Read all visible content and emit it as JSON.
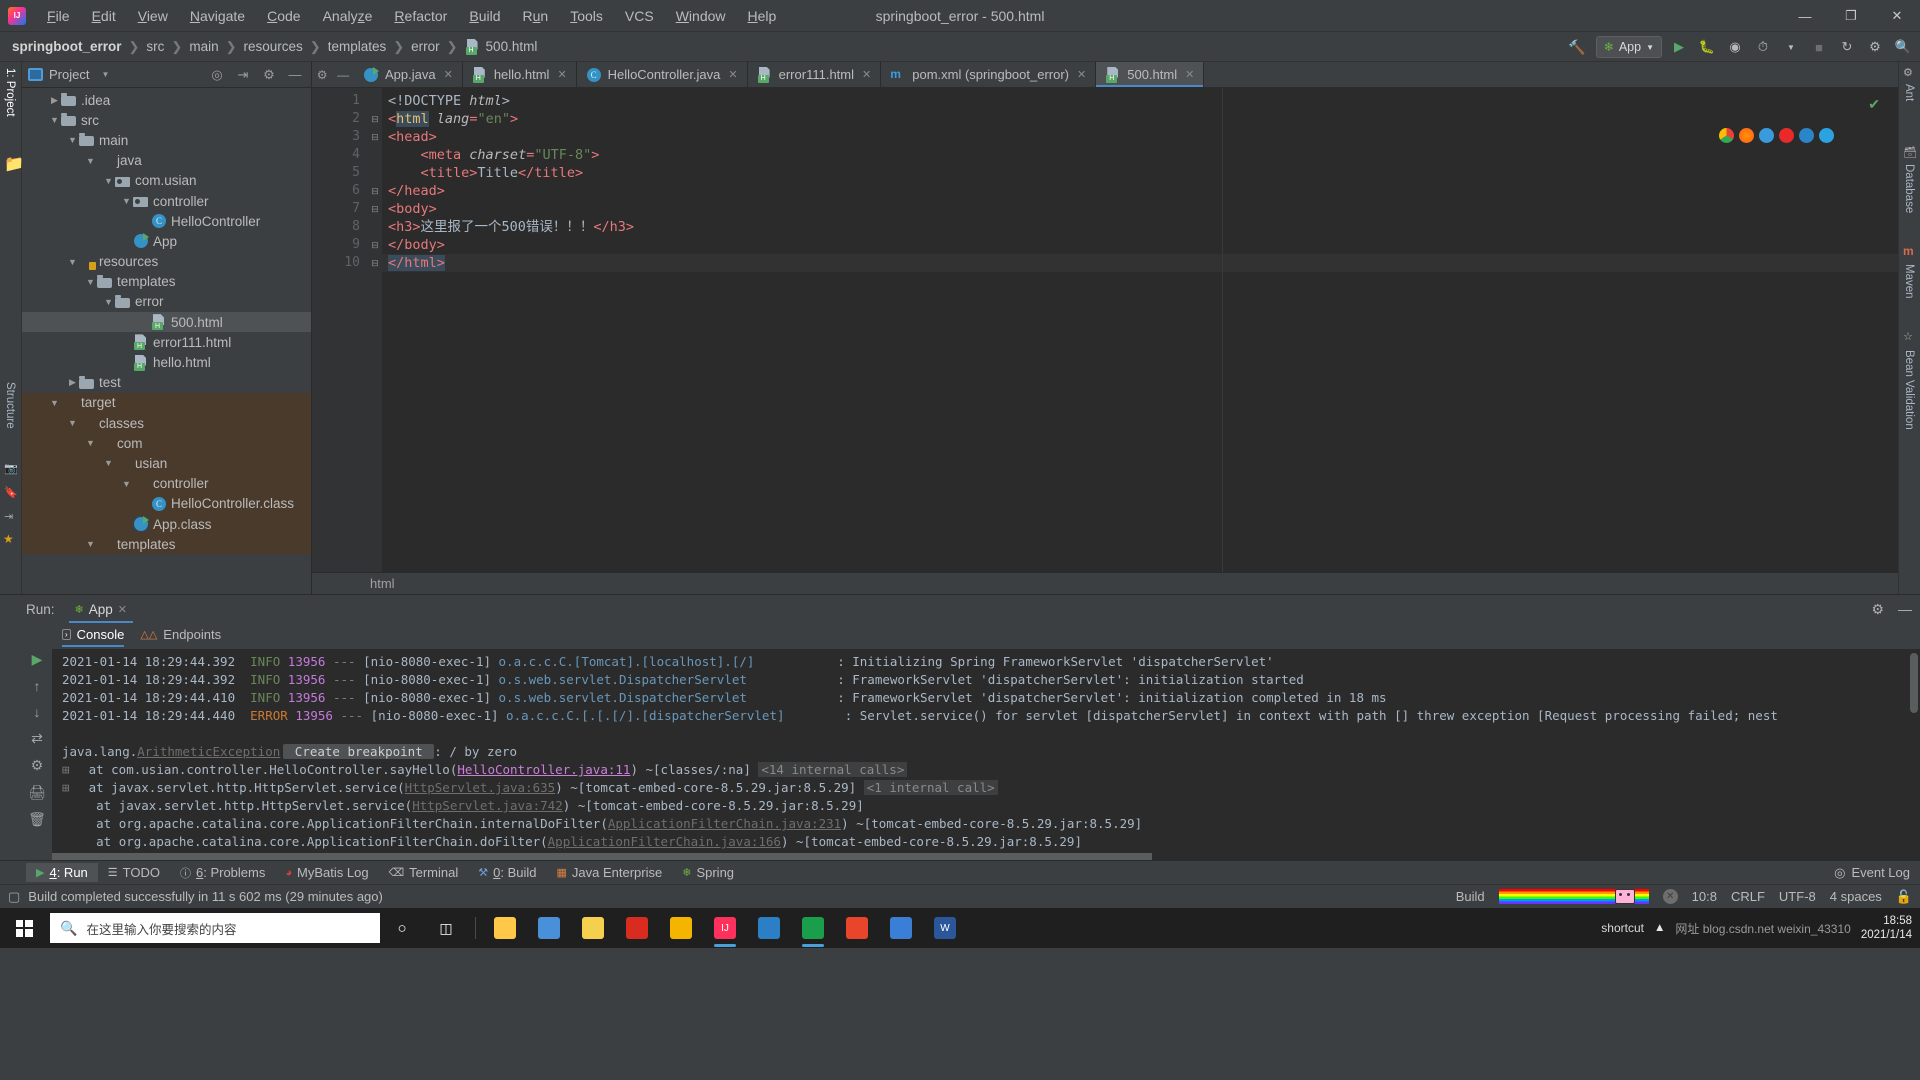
{
  "titlebar": {
    "window_title": "springboot_error - 500.html",
    "logo_icon": "intellij-idea-logo",
    "menus": [
      {
        "label": "File",
        "mnemonic": "F"
      },
      {
        "label": "Edit",
        "mnemonic": "E"
      },
      {
        "label": "View",
        "mnemonic": "V"
      },
      {
        "label": "Navigate",
        "mnemonic": "N"
      },
      {
        "label": "Code",
        "mnemonic": "C"
      },
      {
        "label": "Analyze",
        "mnemonic": "z"
      },
      {
        "label": "Refactor",
        "mnemonic": "R"
      },
      {
        "label": "Build",
        "mnemonic": "B"
      },
      {
        "label": "Run",
        "mnemonic": "u"
      },
      {
        "label": "Tools",
        "mnemonic": "T"
      },
      {
        "label": "VCS",
        "mnemonic": ""
      },
      {
        "label": "Window",
        "mnemonic": "W"
      },
      {
        "label": "Help",
        "mnemonic": "H"
      }
    ],
    "controls": {
      "minimize": "—",
      "maximize": "❐",
      "close": "✕"
    }
  },
  "navbar": {
    "crumbs": [
      "springboot_error",
      "src",
      "main",
      "resources",
      "templates",
      "error",
      "500.html"
    ],
    "separator": "❯",
    "hammer_icon": "build-hammer-icon",
    "run_config": "App",
    "run_config_icon": "spring-boot-icon",
    "actions": [
      "run-icon",
      "debug-icon",
      "run-with-coverage-icon",
      "profile-icon",
      "stop-icon",
      "update-icon",
      "settings-icon",
      "search-icon"
    ]
  },
  "left_strip": {
    "tabs": [
      {
        "label": "1: Project",
        "active": true
      }
    ],
    "bottom_icons": [
      "structure-icon",
      "favorites-icon",
      "web-icon"
    ]
  },
  "project_panel": {
    "title": "Project",
    "title_icon": "project-view-icon",
    "dropdown_icon": "chevron-down-icon",
    "toolbar_icons": [
      "locate-icon",
      "collapse-all-icon",
      "settings-gear-icon",
      "hide-icon"
    ],
    "tree": [
      {
        "label": ".idea",
        "indent": 2,
        "arrow": "collapsed",
        "icon": "folder",
        "selected": false,
        "target": false
      },
      {
        "label": "src",
        "indent": 2,
        "arrow": "expanded",
        "icon": "folder",
        "selected": false,
        "target": false
      },
      {
        "label": "main",
        "indent": 3,
        "arrow": "expanded",
        "icon": "folder",
        "selected": false,
        "target": false
      },
      {
        "label": "java",
        "indent": 4,
        "arrow": "expanded",
        "icon": "folder-blue",
        "selected": false,
        "target": false
      },
      {
        "label": "com.usian",
        "indent": 5,
        "arrow": "expanded",
        "icon": "pkg",
        "selected": false,
        "target": false
      },
      {
        "label": "controller",
        "indent": 6,
        "arrow": "expanded",
        "icon": "pkg",
        "selected": false,
        "target": false
      },
      {
        "label": "HelloController",
        "indent": 7,
        "arrow": "none",
        "icon": "cls",
        "selected": false,
        "target": false
      },
      {
        "label": "App",
        "indent": 6,
        "arrow": "none",
        "icon": "app",
        "selected": false,
        "target": false
      },
      {
        "label": "resources",
        "indent": 3,
        "arrow": "expanded",
        "icon": "folder-res",
        "selected": false,
        "target": false
      },
      {
        "label": "templates",
        "indent": 4,
        "arrow": "expanded",
        "icon": "folder",
        "selected": false,
        "target": false
      },
      {
        "label": "error",
        "indent": 5,
        "arrow": "expanded",
        "icon": "folder",
        "selected": false,
        "target": false
      },
      {
        "label": "500.html",
        "indent": 7,
        "arrow": "none",
        "icon": "html",
        "selected": true,
        "target": false
      },
      {
        "label": "error111.html",
        "indent": 6,
        "arrow": "none",
        "icon": "html",
        "selected": false,
        "target": false
      },
      {
        "label": "hello.html",
        "indent": 6,
        "arrow": "none",
        "icon": "html",
        "selected": false,
        "target": false
      },
      {
        "label": "test",
        "indent": 3,
        "arrow": "collapsed",
        "icon": "folder",
        "selected": false,
        "target": false
      },
      {
        "label": "target",
        "indent": 2,
        "arrow": "expanded",
        "icon": "folder-orange",
        "selected": false,
        "target": true
      },
      {
        "label": "classes",
        "indent": 3,
        "arrow": "expanded",
        "icon": "folder-orange",
        "selected": false,
        "target": true
      },
      {
        "label": "com",
        "indent": 4,
        "arrow": "expanded",
        "icon": "folder-orange",
        "selected": false,
        "target": true
      },
      {
        "label": "usian",
        "indent": 5,
        "arrow": "expanded",
        "icon": "folder-orange",
        "selected": false,
        "target": true
      },
      {
        "label": "controller",
        "indent": 6,
        "arrow": "expanded",
        "icon": "folder-orange",
        "selected": false,
        "target": true
      },
      {
        "label": "HelloController.class",
        "indent": 7,
        "arrow": "none",
        "icon": "cls",
        "selected": false,
        "target": true
      },
      {
        "label": "App.class",
        "indent": 6,
        "arrow": "none",
        "icon": "app",
        "selected": false,
        "target": true
      },
      {
        "label": "templates",
        "indent": 4,
        "arrow": "expanded",
        "icon": "folder-orange",
        "selected": false,
        "target": true
      }
    ]
  },
  "editor": {
    "tabs": [
      {
        "label": "App.java",
        "icon": "spring-java-icon",
        "active": false
      },
      {
        "label": "hello.html",
        "icon": "html-file-icon",
        "active": false
      },
      {
        "label": "HelloController.java",
        "icon": "java-class-icon",
        "active": false
      },
      {
        "label": "error111.html",
        "icon": "html-file-icon",
        "active": false
      },
      {
        "label": "pom.xml (springboot_error)",
        "icon": "maven-icon",
        "active": false
      },
      {
        "label": "500.html",
        "icon": "html-file-icon",
        "active": true
      }
    ],
    "line_numbers": [
      "1",
      "2",
      "3",
      "4",
      "5",
      "6",
      "7",
      "8",
      "9",
      "10"
    ],
    "lines": [
      {
        "n": 1,
        "fold": "",
        "current": false,
        "tokens": [
          {
            "t": "<!DOCTYPE ",
            "c": "t-doctype"
          },
          {
            "t": "html",
            "c": "t-attr"
          },
          {
            "t": ">",
            "c": "t-doctype"
          }
        ],
        "indent": 0
      },
      {
        "n": 2,
        "fold": "-",
        "current": false,
        "tokens": [
          {
            "t": "<",
            "c": "t-pink"
          },
          {
            "t": "html",
            "c": "t-tag hl-match"
          },
          {
            "t": " ",
            "c": "t-text"
          },
          {
            "t": "lang",
            "c": "t-attr"
          },
          {
            "t": "=",
            "c": "t-pink"
          },
          {
            "t": "\"en\"",
            "c": "t-str"
          },
          {
            "t": ">",
            "c": "t-pink"
          }
        ],
        "indent": 0
      },
      {
        "n": 3,
        "fold": "-",
        "current": false,
        "tokens": [
          {
            "t": "<head>",
            "c": "t-pink"
          }
        ],
        "indent": 0
      },
      {
        "n": 4,
        "fold": "",
        "current": false,
        "tokens": [
          {
            "t": "    <",
            "c": "t-pink"
          },
          {
            "t": "meta",
            "c": "t-pink"
          },
          {
            "t": " ",
            "c": "t-text"
          },
          {
            "t": "charset",
            "c": "t-attr"
          },
          {
            "t": "=",
            "c": "t-pink"
          },
          {
            "t": "\"UTF-8\"",
            "c": "t-str"
          },
          {
            "t": ">",
            "c": "t-pink"
          }
        ],
        "indent": 0
      },
      {
        "n": 5,
        "fold": "",
        "current": false,
        "tokens": [
          {
            "t": "    <title>",
            "c": "t-pink"
          },
          {
            "t": "Title",
            "c": "t-text"
          },
          {
            "t": "</title>",
            "c": "t-pink"
          }
        ],
        "indent": 0
      },
      {
        "n": 6,
        "fold": "=",
        "current": false,
        "tokens": [
          {
            "t": "</head>",
            "c": "t-pink"
          }
        ],
        "indent": 0
      },
      {
        "n": 7,
        "fold": "-",
        "current": false,
        "tokens": [
          {
            "t": "<body>",
            "c": "t-pink"
          }
        ],
        "indent": 0
      },
      {
        "n": 8,
        "fold": "",
        "current": false,
        "tokens": [
          {
            "t": "<h3>",
            "c": "t-pink"
          },
          {
            "t": "这里报了一个500错误！！！",
            "c": "t-text"
          },
          {
            "t": "</h3>",
            "c": "t-pink"
          }
        ],
        "indent": 0
      },
      {
        "n": 9,
        "fold": "=",
        "current": false,
        "tokens": [
          {
            "t": "</body>",
            "c": "t-pink"
          }
        ],
        "indent": 0
      },
      {
        "n": 10,
        "fold": "=",
        "current": true,
        "tokens": [
          {
            "t": "</html>",
            "c": "t-pink hl-match"
          }
        ],
        "indent": 0
      }
    ],
    "inspection_status": "✔",
    "breadcrumb_bottom": "html",
    "browser_icons": [
      "chrome-icon",
      "firefox-icon",
      "safari-icon",
      "opera-icon",
      "edge-icon",
      "ie-icon"
    ]
  },
  "right_strip": {
    "tabs": [
      "Ant",
      "Database",
      "Maven",
      "Bean Validation"
    ]
  },
  "run_window": {
    "label": "Run:",
    "config_name": "App",
    "config_icon": "spring-boot-icon",
    "close_icon": "close-icon",
    "settings_icon": "gear-icon",
    "hide_icon": "minimize-icon",
    "tabs": [
      {
        "label": "Console",
        "icon": "console-icon",
        "active": true
      },
      {
        "label": "Endpoints",
        "icon": "endpoints-icon",
        "active": false
      }
    ],
    "toolbar_icons": [
      "rerun-icon",
      "scroll-up-icon",
      "scroll-down-icon",
      "soft-wrap-icon",
      "print-icon",
      "clear-all-icon"
    ],
    "console_lines": [
      {
        "date": "2021-01-14 18:29:44.392",
        "level": "INFO",
        "pid": "13956",
        "thread": "[nio-8080-exec-1]",
        "logger": "o.a.c.c.C.[Tomcat].[localhost].[/]",
        "logger_pad": 9,
        "message": ": Initializing Spring FrameworkServlet 'dispatcherServlet'"
      },
      {
        "date": "2021-01-14 18:29:44.392",
        "level": "INFO",
        "pid": "13956",
        "thread": "[nio-8080-exec-1]",
        "logger": "o.s.web.servlet.DispatcherServlet",
        "logger_pad": 9,
        "message": ": FrameworkServlet 'dispatcherServlet': initialization started"
      },
      {
        "date": "2021-01-14 18:29:44.410",
        "level": "INFO",
        "pid": "13956",
        "thread": "[nio-8080-exec-1]",
        "logger": "o.s.web.servlet.DispatcherServlet",
        "logger_pad": 9,
        "message": ": FrameworkServlet 'dispatcherServlet': initialization completed in 18 ms"
      },
      {
        "date": "2021-01-14 18:29:44.440",
        "level": "ERROR",
        "pid": "13956",
        "thread": "[nio-8080-exec-1]",
        "logger": "o.a.c.c.C.[.[.[/].[dispatcherServlet]",
        "logger_pad": 4,
        "message": ": Servlet.service() for servlet [dispatcherServlet] in context with path [] threw exception [Request processing failed; nest"
      }
    ],
    "exception_header": {
      "prefix": "java.lang.",
      "type": "ArithmeticException",
      "breakpoint_badge": "Create breakpoint",
      "suffix": ": / by zero"
    },
    "stack_frames": [
      {
        "expand": "⊞",
        "text": "at com.usian.controller.HelloController.sayHello(",
        "link": "HelloController.java:11",
        "tail": ") ~[classes/:na]",
        "badge": "<14 internal calls>",
        "link_style": "pink"
      },
      {
        "expand": "⊞",
        "text": "at javax.servlet.http.HttpServlet.service(",
        "link": "HttpServlet.java:635",
        "tail": ") ~[tomcat-embed-core-8.5.29.jar:8.5.29]",
        "badge": "<1 internal call>",
        "link_style": "dim"
      },
      {
        "expand": "",
        "text": "at javax.servlet.http.HttpServlet.service(",
        "link": "HttpServlet.java:742",
        "tail": ") ~[tomcat-embed-core-8.5.29.jar:8.5.29]",
        "badge": "",
        "link_style": "dim"
      },
      {
        "expand": "",
        "text": "at org.apache.catalina.core.ApplicationFilterChain.internalDoFilter(",
        "link": "ApplicationFilterChain.java:231",
        "tail": ") ~[tomcat-embed-core-8.5.29.jar:8.5.29]",
        "badge": "",
        "link_style": "dim"
      },
      {
        "expand": "",
        "text": "at org.apache.catalina.core.ApplicationFilterChain.doFilter(",
        "link": "ApplicationFilterChain.java:166",
        "tail": ") ~[tomcat-embed-core-8.5.29.jar:8.5.29]",
        "badge": "",
        "link_style": "dim"
      }
    ]
  },
  "bottom_bar": {
    "buttons": [
      {
        "label": "4: Run",
        "mnemonic": "4",
        "icon": "run-icon",
        "active": true
      },
      {
        "label": "TODO",
        "mnemonic": "",
        "icon": "todo-icon",
        "active": false
      },
      {
        "label": "6: Problems",
        "mnemonic": "6",
        "icon": "problems-icon",
        "active": false
      },
      {
        "label": "MyBatis Log",
        "mnemonic": "",
        "icon": "mybatis-icon",
        "active": false
      },
      {
        "label": "Terminal",
        "mnemonic": "",
        "icon": "terminal-icon",
        "active": false
      },
      {
        "label": "0: Build",
        "mnemonic": "0",
        "icon": "build-icon",
        "active": false
      },
      {
        "label": "Java Enterprise",
        "mnemonic": "",
        "icon": "java-enterprise-icon",
        "active": false
      },
      {
        "label": "Spring",
        "mnemonic": "",
        "icon": "spring-icon",
        "active": false
      }
    ],
    "event_log": "Event Log",
    "event_log_icon": "event-log-icon"
  },
  "status_bar": {
    "message": "Build completed successfully in 11 s 602 ms (29 minutes ago)",
    "message_icon": "build-status-icon",
    "build_label": "Build",
    "progress_icon": "nyan-cat-progress",
    "cancel_icon": "cancel-icon",
    "caret_position": "10:8",
    "line_separator": "CRLF",
    "encoding": "UTF-8",
    "indent": "4 spaces",
    "lock_icon": "lock-icon"
  },
  "taskbar": {
    "start_icon": "windows-start-icon",
    "search_placeholder": "在这里输入你要搜索的内容",
    "search_icon": "search-icon",
    "cortana_icon": "cortana-icon",
    "taskview_icon": "task-view-icon",
    "apps": [
      {
        "name": "file-explorer-icon",
        "color": "#ffc848",
        "glyph": "",
        "running": false
      },
      {
        "name": "this-pc-icon",
        "color": "#4a90d9",
        "glyph": "",
        "running": false
      },
      {
        "name": "tim-icon",
        "color": "#f5d04e",
        "glyph": "",
        "running": false
      },
      {
        "name": "redis-icon",
        "color": "#d82c20",
        "glyph": "",
        "running": false
      },
      {
        "name": "chrome-icon",
        "color": "#f4b400",
        "glyph": "",
        "running": false
      },
      {
        "name": "intellij-idea-icon",
        "color": "#fe315d",
        "glyph": "IJ",
        "running": true
      },
      {
        "name": "navicat-icon",
        "color": "#2b7fc4",
        "glyph": "",
        "running": false
      },
      {
        "name": "idea-project-icon",
        "color": "#1b9e4b",
        "glyph": "",
        "running": true
      },
      {
        "name": "xmind-icon",
        "color": "#e8452c",
        "glyph": "",
        "running": false
      },
      {
        "name": "typora-icon",
        "color": "#3a7fd5",
        "glyph": "",
        "running": false
      },
      {
        "name": "word-icon",
        "color": "#2b579a",
        "glyph": "W",
        "running": false
      }
    ],
    "tray_shortcut": "shortcut",
    "tray_watermark": "网址 blog.csdn.net  weixin_43310",
    "clock_time": "18:58",
    "clock_date": "2021/1/14"
  }
}
